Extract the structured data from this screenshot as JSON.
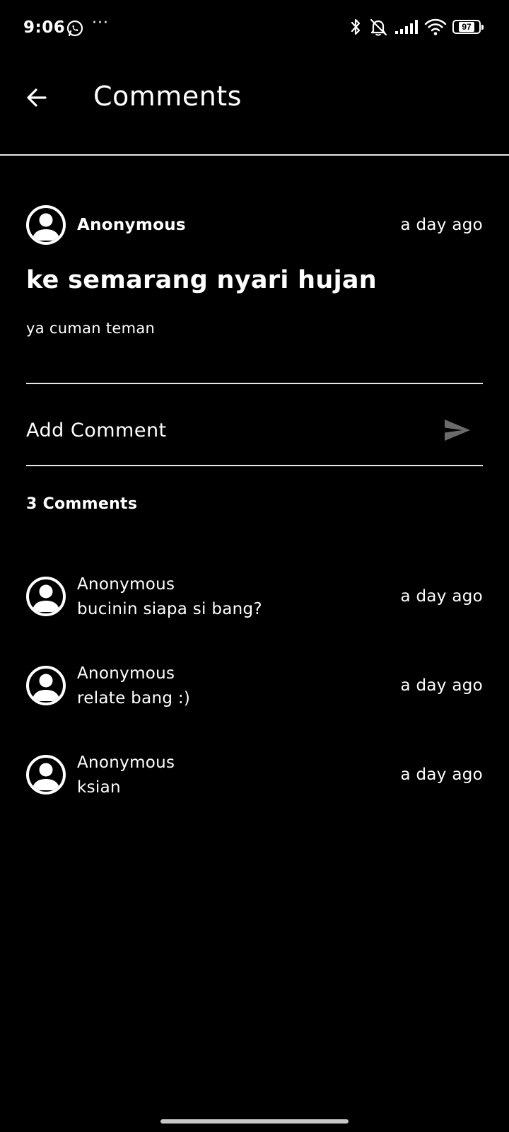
{
  "status_bar": {
    "time": "9:06",
    "notification_dots": "···",
    "battery_level": "97",
    "icons": [
      "whatsapp-icon",
      "bluetooth-icon",
      "muted-bell-icon",
      "signal-icon",
      "wifi-icon",
      "battery-icon"
    ]
  },
  "app_bar": {
    "title": "Comments",
    "back_icon": "arrow-back-icon"
  },
  "post": {
    "author": "Anonymous",
    "time": "a day ago",
    "title": "ke semarang nyari hujan",
    "body": "ya cuman teman"
  },
  "add_comment": {
    "placeholder": "Add Comment",
    "send_icon": "send-icon",
    "send_icon_color": "#6b6b6b"
  },
  "comments_count_label": "3 Comments",
  "comments": [
    {
      "author": "Anonymous",
      "body": "bucinin siapa si bang?",
      "time": "a day ago"
    },
    {
      "author": "Anonymous",
      "body": "relate bang :)",
      "time": "a day ago"
    },
    {
      "author": "Anonymous",
      "body": "ksian",
      "time": "a day ago"
    }
  ],
  "colors": {
    "background": "#000000",
    "text": "#ffffff",
    "divider": "#e6e6e6"
  }
}
